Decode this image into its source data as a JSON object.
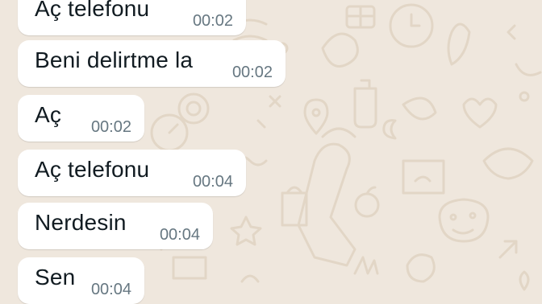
{
  "colors": {
    "chat_background": "#efe7dd",
    "bubble_background": "#ffffff",
    "message_text": "#111b21",
    "timestamp_text": "#667781",
    "doodle_stroke": "#e2d6c6"
  },
  "messages": [
    {
      "text": "Aç telefonu",
      "time": "00:02"
    },
    {
      "text": "Beni delirtme la",
      "time": "00:02"
    },
    {
      "text": "Aç",
      "time": "00:02"
    },
    {
      "text": "Aç telefonu",
      "time": "00:04"
    },
    {
      "text": "Nerdesin",
      "time": "00:04"
    },
    {
      "text": "Sen",
      "time": "00:04"
    }
  ]
}
